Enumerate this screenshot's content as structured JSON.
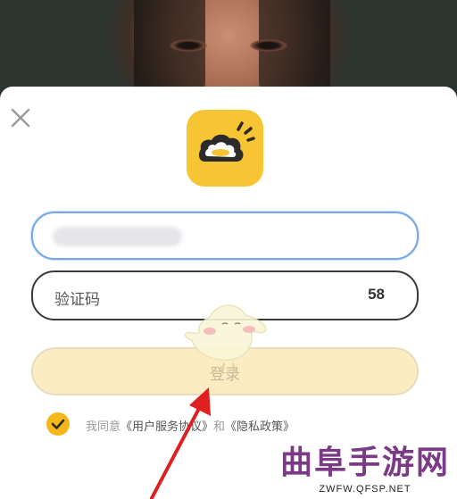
{
  "form": {
    "code_placeholder": "验证码",
    "countdown": "58",
    "login_label": "登录"
  },
  "agreement": {
    "prefix": "我同意",
    "terms_link": "《用户服务协议》",
    "conjunction": "和",
    "privacy_link": "《隐私政策》",
    "checked": true
  },
  "watermark": {
    "title": "曲阜手游网",
    "url": "ZWFW.QFSP.NET"
  },
  "colors": {
    "brand_yellow": "#f7c533",
    "check_yellow": "#f5b71c",
    "focus_blue": "#7aa7e6",
    "login_disabled_bg": "#fbedc1",
    "annotation_red": "#e02020",
    "watermark_purple": "#7a3a86"
  },
  "icons": {
    "close": "close-icon",
    "logo": "app-logo-icon",
    "check": "checkmark-icon"
  }
}
